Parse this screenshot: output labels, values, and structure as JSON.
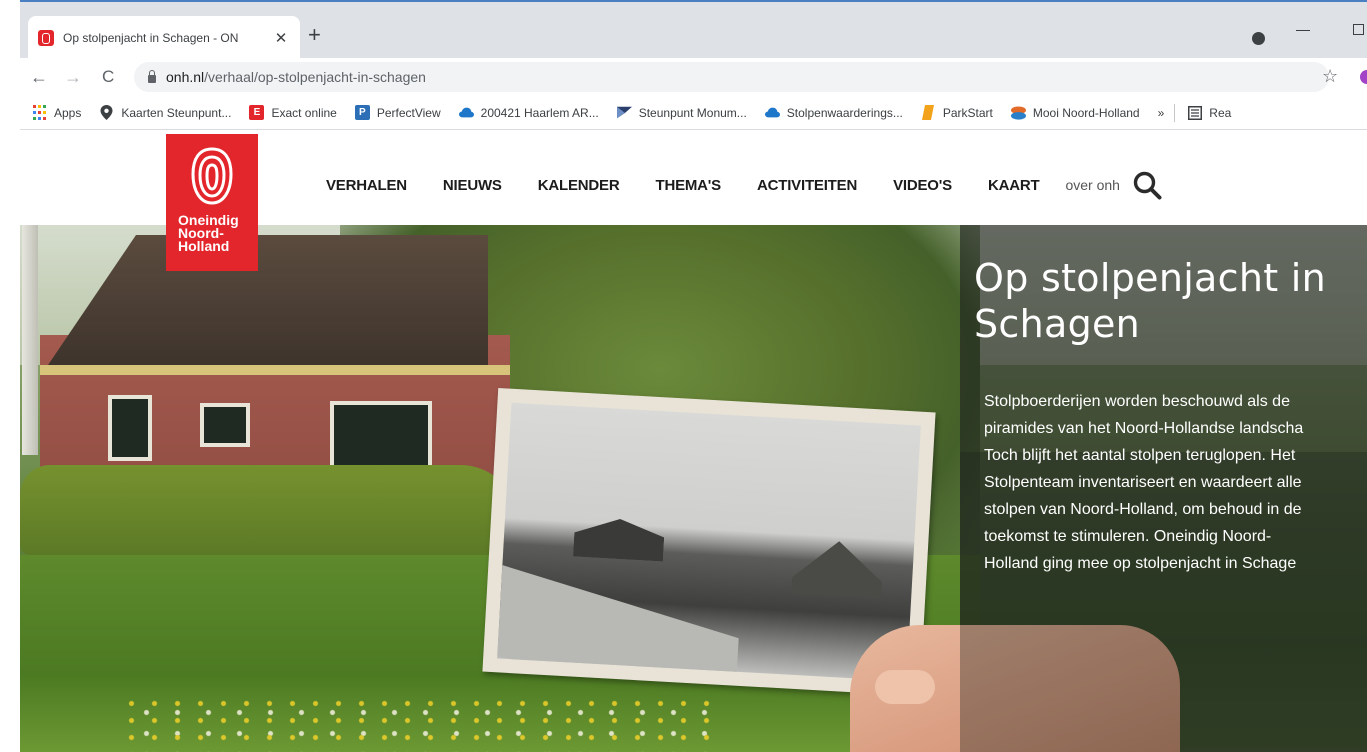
{
  "browser": {
    "tab": {
      "title": "Op stolpenjacht in Schagen - ON",
      "close_glyph": "✕"
    },
    "new_tab_glyph": "+",
    "url": {
      "host": "onh.nl",
      "path": "/verhaal/op-stolpenjacht-in-schagen"
    },
    "nav": {
      "back": "←",
      "forward": "→",
      "reload": "C"
    },
    "star_glyph": "☆",
    "bookmarks": [
      {
        "label": "Apps",
        "icon": "apps-grid-icon"
      },
      {
        "label": "Kaarten Steunpunt...",
        "icon": "map-pin-icon",
        "color": "#3c4043"
      },
      {
        "label": "Exact online",
        "icon": "exact-logo-icon",
        "color": "#e3262c",
        "glyph": "E"
      },
      {
        "label": "PerfectView",
        "icon": "perfectview-logo-icon",
        "color": "#2d6fb7",
        "glyph": "P"
      },
      {
        "label": "200421 Haarlem AR...",
        "icon": "cloud-icon",
        "color": "#1f77c9"
      },
      {
        "label": "Steunpunt Monum...",
        "icon": "flag-icon",
        "color": "#2a3f6b"
      },
      {
        "label": "Stolpenwaarderings...",
        "icon": "cloud-icon",
        "color": "#1f77c9"
      },
      {
        "label": "ParkStart",
        "icon": "parkstart-icon",
        "color": "#f2a31b"
      },
      {
        "label": "Mooi Noord-Holland",
        "icon": "mooi-nh-icon",
        "color": "#e26b2a"
      }
    ],
    "bookmarks_more": "»",
    "reading_list_label": "Rea"
  },
  "site": {
    "logo_lines": [
      "Oneindig",
      "Noord-",
      "Holland"
    ],
    "nav": [
      "VERHALEN",
      "NIEUWS",
      "KALENDER",
      "THEMA'S",
      "ACTIVITEITEN",
      "VIDEO'S",
      "KAART"
    ],
    "about": "over onh"
  },
  "hero": {
    "title_lines": [
      "Op stolpenjacht in",
      "Schagen"
    ],
    "body_lines": [
      "Stolpboerderijen worden beschouwd als de",
      "piramides van het Noord-Hollandse landscha",
      "Toch blijft het aantal stolpen teruglopen. Het",
      "Stolpenteam inventariseert en waardeert alle",
      "stolpen van Noord-Holland, om behoud in de",
      "toekomst te stimuleren. Oneindig Noord-",
      "Holland ging mee op stolpenjacht in Schage"
    ]
  },
  "colors": {
    "brand_red": "#e3262c",
    "chrome_bg": "#dee1e6"
  }
}
